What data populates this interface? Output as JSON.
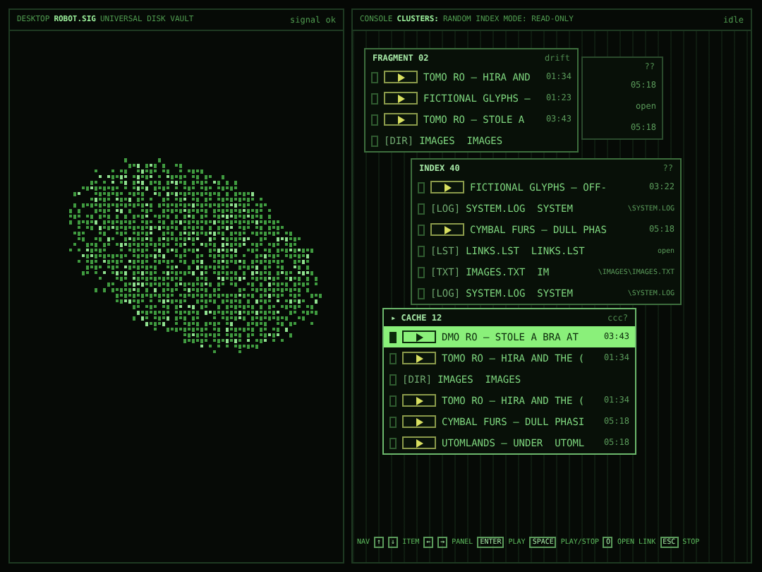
{
  "desktop": {
    "crumbs": [
      {
        "text": "DESKTOP",
        "highlighted": false
      },
      {
        "text": "ROBOT.SIG",
        "highlighted": true
      },
      {
        "text": "UNIVERSAL DISK VAULT",
        "highlighted": false
      }
    ],
    "status": "signal ok"
  },
  "console": {
    "crumbs": [
      {
        "text": "CONSOLE",
        "highlighted": false
      },
      {
        "text": "CLUSTERS:",
        "highlighted": true
      },
      {
        "text": "RANDOM INDEX",
        "highlighted": false
      },
      {
        "text": "MODE: READ-ONLY",
        "highlighted": false
      }
    ],
    "status": "idle",
    "windows": [
      {
        "title": "FRAGMENT 02",
        "badge": "drift",
        "rows": [
          {
            "kind": "track",
            "title": "TOMO RO — HIRA AND",
            "time": "01:34",
            "selected": false
          },
          {
            "kind": "track",
            "title": "FICTIONAL GLYPHS —",
            "time": "01:23",
            "selected": false
          },
          {
            "kind": "track",
            "title": "TOMO RO — STOLE A",
            "time": "03:43",
            "selected": false
          },
          {
            "kind": "file",
            "tag": "[DIR]",
            "name": "IMAGES  IMAGES",
            "selected": false
          }
        ]
      },
      {
        "badge": "??",
        "rows": [
          {
            "kind": "meta",
            "text": "05:18",
            "selected": false
          },
          {
            "kind": "meta",
            "text": "open",
            "selected": false
          },
          {
            "kind": "meta",
            "text": "05:18",
            "selected": false
          }
        ]
      },
      {
        "title": "INDEX 40",
        "badge": "??",
        "rows": [
          {
            "kind": "track",
            "title": "FICTIONAL GLYPHS — OFF-",
            "time": "03:22",
            "selected": false
          },
          {
            "kind": "file",
            "tag": "[LOG]",
            "name": "SYSTEM.LOG  SYSTEM",
            "meta": "\\SYSTEM.LOG",
            "selected": false
          },
          {
            "kind": "track",
            "title": "CYMBAL FURS — DULL PHAS",
            "time": "05:18",
            "selected": false
          },
          {
            "kind": "file",
            "tag": "[LST]",
            "name": "LINKS.LST  LINKS.LST",
            "meta": "open",
            "selected": false
          },
          {
            "kind": "file",
            "tag": "[TXT]",
            "name": "IMAGES.TXT  IM",
            "meta": "\\IMAGES\\IMAGES.TXT",
            "selected": false
          },
          {
            "kind": "file",
            "tag": "[LOG]",
            "name": "SYSTEM.LOG  SYSTEM",
            "meta": "\\SYSTEM.LOG",
            "selected": false
          }
        ]
      },
      {
        "title": "▸ CACHE 12",
        "badge": "ccc?",
        "rows": [
          {
            "kind": "track",
            "title": "DMO RO — STOLE A BRA AT",
            "time": "03:43",
            "selected": true
          },
          {
            "kind": "track",
            "title": "TOMO RO — HIRA AND THE (",
            "time": "01:34",
            "selected": false
          },
          {
            "kind": "file",
            "tag": "[DIR]",
            "name": "IMAGES  IMAGES",
            "selected": false
          },
          {
            "kind": "track",
            "title": "TOMO RO — HIRA AND THE (",
            "time": "01:34",
            "selected": false
          },
          {
            "kind": "track",
            "title": "CYMBAL FURS — DULL PHASI",
            "time": "05:18",
            "selected": false
          },
          {
            "kind": "track",
            "title": "UTOMLANDS — UNDER  UTOML",
            "time": "05:18",
            "selected": false
          }
        ]
      }
    ],
    "shortcuts": [
      {
        "kind": "label",
        "text": "NAV"
      },
      {
        "kind": "key",
        "text": "↑"
      },
      {
        "kind": "key",
        "text": "↓"
      },
      {
        "kind": "label",
        "text": "ITEM"
      },
      {
        "kind": "key",
        "text": "←"
      },
      {
        "kind": "key",
        "text": "→"
      },
      {
        "kind": "label",
        "text": "PANEL"
      },
      {
        "kind": "key",
        "text": "ENTER"
      },
      {
        "kind": "label",
        "text": "PLAY"
      },
      {
        "kind": "key",
        "text": "SPACE"
      },
      {
        "kind": "label",
        "text": "PLAY/STOP"
      },
      {
        "kind": "key",
        "text": "O"
      },
      {
        "kind": "label",
        "text": "OPEN LINK"
      },
      {
        "kind": "key",
        "text": "ESC"
      },
      {
        "kind": "label",
        "text": "STOP"
      }
    ]
  }
}
